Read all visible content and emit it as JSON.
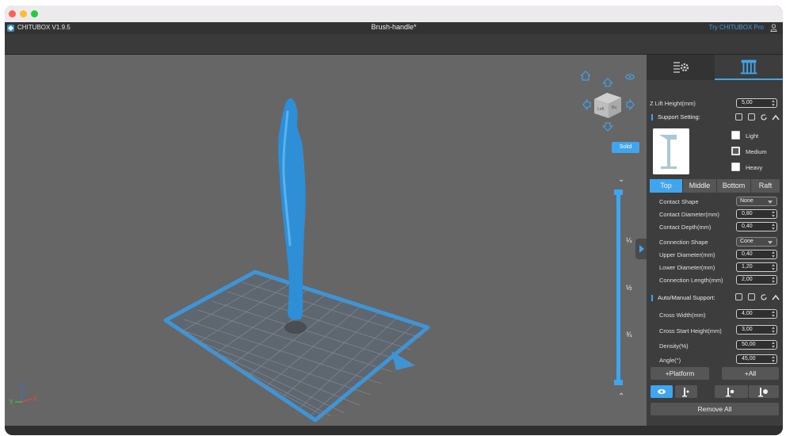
{
  "window": {
    "app_name": "CHITUBOX V1.9.5",
    "doc_title": "Brush-handle*",
    "try_pro": "Try CHITUBOX Pro"
  },
  "viewport": {
    "view_mode": "Solid",
    "cube_face_front": "Left",
    "cube_face_side": "Ba",
    "slider_marks": [
      "¼",
      "½",
      "¾"
    ],
    "axis_labels": {
      "z": "Z",
      "y": "Y",
      "x": "X"
    }
  },
  "panel": {
    "z_lift_label": "Z Lift Height(mm)",
    "z_lift_value": "5,00",
    "support_setting_label": "Support Setting:",
    "density_options": [
      {
        "label": "Light",
        "checked": false
      },
      {
        "label": "Medium",
        "checked": true
      },
      {
        "label": "Heavy",
        "checked": false
      }
    ],
    "tabs": [
      "Top",
      "Middle",
      "Bottom",
      "Raft"
    ],
    "active_tab": "Top",
    "top_settings": {
      "contact_shape_label": "Contact Shape",
      "contact_shape_value": "None",
      "contact_diameter_label": "Contact Diameter(mm)",
      "contact_diameter_value": "0,80",
      "contact_depth_label": "Contact Depth(mm)",
      "contact_depth_value": "0,40",
      "connection_shape_label": "Connection Shape",
      "connection_shape_value": "Cone",
      "upper_diameter_label": "Upper Diameter(mm)",
      "upper_diameter_value": "0,40",
      "lower_diameter_label": "Lower Diameter(mm)",
      "lower_diameter_value": "1,20",
      "connection_length_label": "Connection Length(mm)",
      "connection_length_value": "2,00"
    },
    "auto_manual_label": "Auto/Manual Support:",
    "auto_settings": {
      "cross_width_label": "Cross Width(mm)",
      "cross_width_value": "4,00",
      "cross_start_label": "Cross Start Height(mm)",
      "cross_start_value": "3,00",
      "density_label": "Density(%)",
      "density_value": "50,00",
      "angle_label": "Angle(°)",
      "angle_value": "45,00"
    },
    "platform_button": "+Platform",
    "all_button": "+All",
    "remove_all_button": "Remove All"
  },
  "colors": {
    "accent": "#3fa5ee",
    "model": "#2e8fd6",
    "background": "#666666"
  }
}
